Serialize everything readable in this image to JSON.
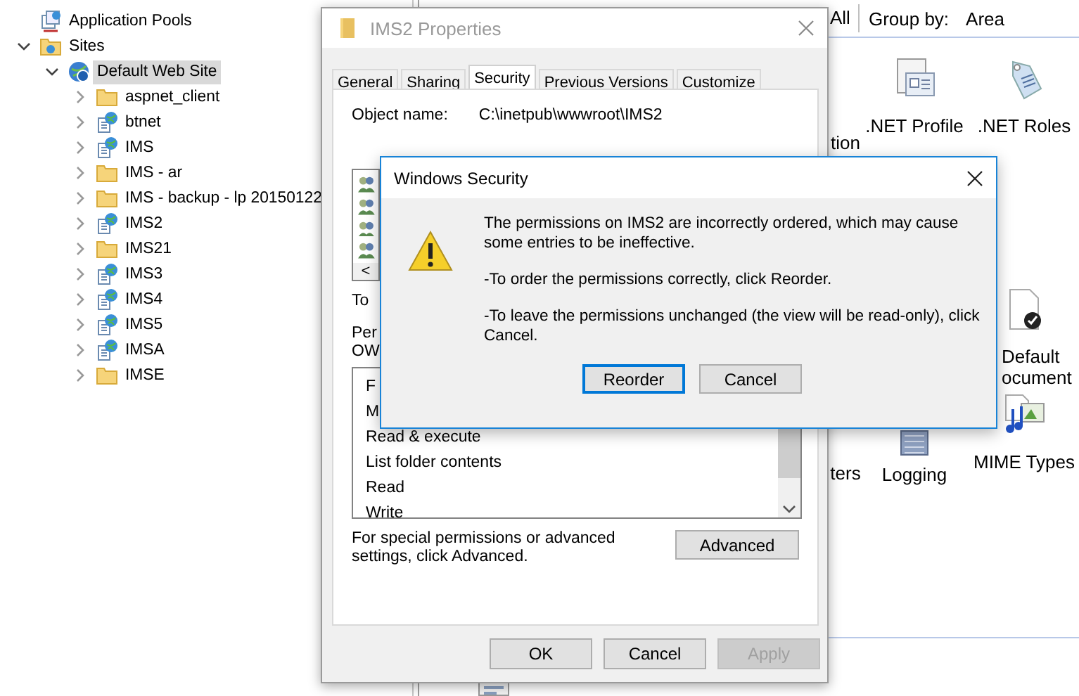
{
  "tree": [
    {
      "label": "Application Pools",
      "kind": "pools",
      "selected": false
    },
    {
      "label": "Sites",
      "kind": "sites",
      "selected": false,
      "expanded": true,
      "children": [
        {
          "label": "Default Web Site",
          "kind": "website",
          "selected": true,
          "expanded": true,
          "children": [
            {
              "label": "aspnet_client",
              "kind": "folder",
              "selected": false,
              "expanded": false
            },
            {
              "label": "btnet",
              "kind": "app",
              "selected": false,
              "expanded": false
            },
            {
              "label": "IMS",
              "kind": "app",
              "selected": false,
              "expanded": false
            },
            {
              "label": "IMS - ar",
              "kind": "folder",
              "selected": false,
              "expanded": false
            },
            {
              "label": "IMS - backup - lp 20150122",
              "kind": "folder",
              "selected": false,
              "expanded": false
            },
            {
              "label": "IMS2",
              "kind": "app",
              "selected": false,
              "expanded": false
            },
            {
              "label": "IMS21",
              "kind": "folder",
              "selected": false,
              "expanded": false
            },
            {
              "label": "IMS3",
              "kind": "app",
              "selected": false,
              "expanded": false
            },
            {
              "label": "IMS4",
              "kind": "app",
              "selected": false,
              "expanded": false
            },
            {
              "label": "IMS5",
              "kind": "app",
              "selected": false,
              "expanded": false
            },
            {
              "label": "IMSA",
              "kind": "app",
              "selected": false,
              "expanded": false
            },
            {
              "label": "IMSE",
              "kind": "folder",
              "selected": false,
              "expanded": false
            }
          ]
        }
      ]
    }
  ],
  "features_view": {
    "show_all": "All",
    "group_by_label": "Group by:",
    "group_by_value": "Area",
    "features": [
      {
        "lines": [
          "tion"
        ],
        "kind": "hidden"
      },
      {
        "lines": [
          ".NET Profile"
        ],
        "kind": "profile"
      },
      {
        "lines": [
          ".NET Roles"
        ],
        "kind": "roles"
      },
      {
        "lines": [
          "Default",
          "ocument"
        ],
        "kind": "document"
      },
      {
        "lines": [
          "ters"
        ],
        "kind": "hidden"
      },
      {
        "lines": [
          "Logging"
        ],
        "kind": "logging"
      },
      {
        "lines": [
          "MIME Types"
        ],
        "kind": "mime"
      },
      {
        "kind": "module"
      }
    ]
  },
  "properties_dialog": {
    "title": "IMS2 Properties",
    "tabs": [
      {
        "label": "General",
        "selected": false
      },
      {
        "label": "Sharing",
        "selected": false
      },
      {
        "label": "Security",
        "selected": true
      },
      {
        "label": "Previous Versions",
        "selected": false
      },
      {
        "label": "Customize",
        "selected": false
      }
    ],
    "object_name_label": "Object name:",
    "object_name_value": "C:\\inetpub\\wwwroot\\IMS2",
    "users_scroll_left": "<",
    "change_text_partial": "To",
    "permissions_label_partial": "Per",
    "permissions_owner_partial": "OW",
    "permissions": [
      "F",
      "M",
      "Read & execute",
      "List folder contents",
      "Read",
      "Write"
    ],
    "advanced_note": "For special permissions or advanced settings, click Advanced.",
    "advanced_button": "Advanced",
    "buttons": [
      {
        "label": "OK",
        "disabled": false
      },
      {
        "label": "Cancel",
        "disabled": false
      },
      {
        "label": "Apply",
        "disabled": true
      }
    ]
  },
  "security_dialog": {
    "title": "Windows Security",
    "message": "The permissions on IMS2 are incorrectly ordered, which may cause some entries to be ineffective.",
    "hints": [
      "-To order the permissions correctly, click Reorder.",
      "-To leave the permissions unchanged (the view will be read-only), click Cancel."
    ],
    "buttons": [
      {
        "label": "Reorder",
        "focused": true
      },
      {
        "label": "Cancel",
        "focused": false
      }
    ]
  }
}
